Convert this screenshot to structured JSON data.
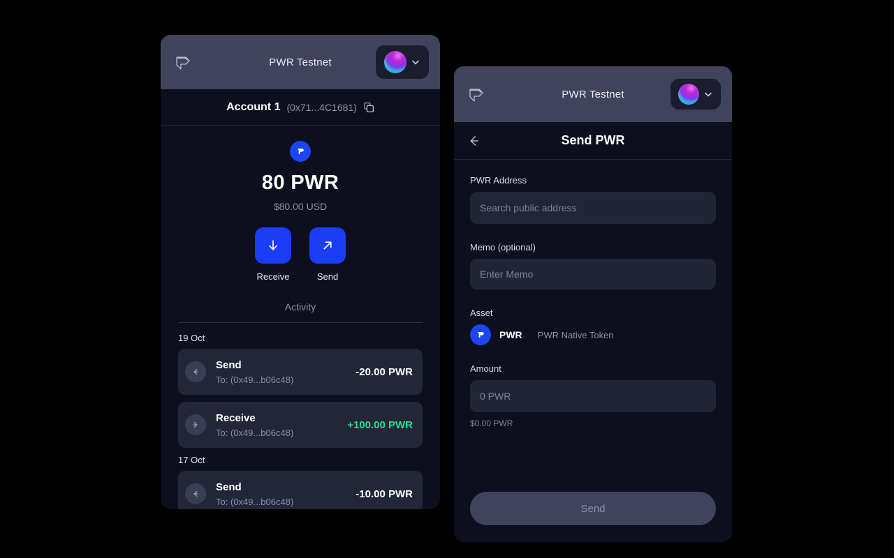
{
  "wallet": {
    "topbar": {
      "logo_icon": "pwr-logo-icon",
      "network": "PWR Testnet",
      "avatar_icon": "account-avatar",
      "chevron_icon": "chevron-down-icon"
    },
    "account": {
      "name": "Account 1",
      "address": "(0x71...4C1681)",
      "copy_icon": "copy-icon"
    },
    "balance": {
      "token_icon": "pwr-token-icon",
      "amount": "80 PWR",
      "fiat": "$80.00 USD"
    },
    "actions": [
      {
        "label": "Receive",
        "icon": "arrow-down-icon"
      },
      {
        "label": "Send",
        "icon": "arrow-up-right-icon"
      }
    ],
    "activity": {
      "title": "Activity",
      "groups": [
        {
          "date": "19 Oct",
          "items": [
            {
              "kind": "Send",
              "to": "To: (0x49...b06c48)",
              "amount": "-20.00 PWR",
              "direction": "out",
              "icon": "arrow-left-icon"
            },
            {
              "kind": "Receive",
              "to": "To: (0x49...b06c48)",
              "amount": "+100.00 PWR",
              "direction": "in",
              "icon": "arrow-right-icon"
            }
          ]
        },
        {
          "date": "17 Oct",
          "items": [
            {
              "kind": "Send",
              "to": "To: (0x49...b06c48)",
              "amount": "-10.00 PWR",
              "direction": "out",
              "icon": "arrow-left-icon"
            }
          ]
        }
      ]
    }
  },
  "send": {
    "topbar": {
      "logo_icon": "pwr-logo-icon",
      "network": "PWR Testnet",
      "avatar_icon": "account-avatar",
      "chevron_icon": "chevron-down-icon"
    },
    "header": {
      "back_icon": "arrow-left-icon",
      "title": "Send PWR"
    },
    "address_field": {
      "label": "PWR Address",
      "placeholder": "Search public address",
      "value": ""
    },
    "memo_field": {
      "label": "Memo (optional)",
      "placeholder": "Enter Memo",
      "value": ""
    },
    "asset": {
      "label": "Asset",
      "icon": "pwr-token-icon",
      "symbol": "PWR",
      "description": "PWR Native Token"
    },
    "amount_field": {
      "label": "Amount",
      "placeholder": "0 PWR",
      "value": "",
      "hint": "$0.00 PWR"
    },
    "submit": {
      "label": "Send",
      "disabled": true
    }
  },
  "colors": {
    "page_bg": "#000000",
    "panel_bg": "#0d0f1e",
    "topbar_bg": "#41435c",
    "accent_blue": "#1a3df5",
    "positive_green": "#22e08a",
    "muted_text": "#8b8fa8"
  }
}
